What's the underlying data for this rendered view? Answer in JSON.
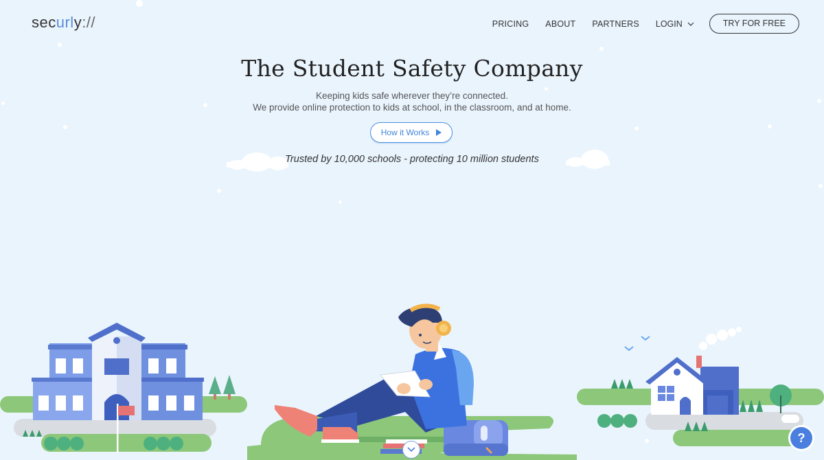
{
  "header": {
    "logo": {
      "pre": "sec",
      "highlight": "url",
      "post": "y",
      "slashes": "://"
    },
    "nav": [
      {
        "label": "PRICING"
      },
      {
        "label": "ABOUT"
      },
      {
        "label": "PARTNERS"
      }
    ],
    "login_label": "LOGIN",
    "cta_label": "TRY FOR FREE"
  },
  "hero": {
    "title": "The Student Safety Company",
    "subtitle_line1": "Keeping kids safe wherever they’re connected.",
    "subtitle_line2": "We provide online protection to kids at school, in the classroom, and at home.",
    "button_label": "How it Works",
    "trusted_text": "Trusted by 10,000 schools - protecting 10 million students"
  },
  "help": {
    "label": "?"
  },
  "colors": {
    "background": "#eaf4fd",
    "accent": "#4a8ee0",
    "grass": "#8cc77a",
    "school_blue": "#6a8ce0",
    "boy_shirt": "#3b72e0"
  },
  "icons": [
    "chevron-down-icon",
    "play-icon",
    "help-icon",
    "scroll-down-icon"
  ]
}
